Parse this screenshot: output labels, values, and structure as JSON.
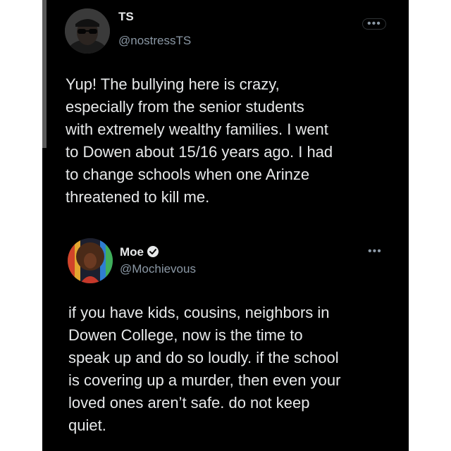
{
  "tweets": [
    {
      "name": "TS",
      "handle": "@nostressTS",
      "verified": false,
      "more_icon": "ellipsis-icon",
      "text": "Yup! The bullying here is crazy,\nespecially from the senior students\nwith extremely wealthy families. I went\nto Dowen about 15/16 years ago. I had\nto change schools when one Arinze\nthreatened to kill me."
    },
    {
      "name": "Moe",
      "handle": "@Mochievous",
      "verified": true,
      "more_icon": "ellipsis-icon",
      "text": "if you have kids, cousins, neighbors in\nDowen College, now is the time to\nspeak up and do so loudly. if the school\nis covering up a murder, then even your\nloved ones aren’t safe. do not keep\nquiet."
    }
  ],
  "colors": {
    "background": "#000000",
    "text_primary": "#e7e9ea",
    "text_secondary": "#8b98a5"
  }
}
